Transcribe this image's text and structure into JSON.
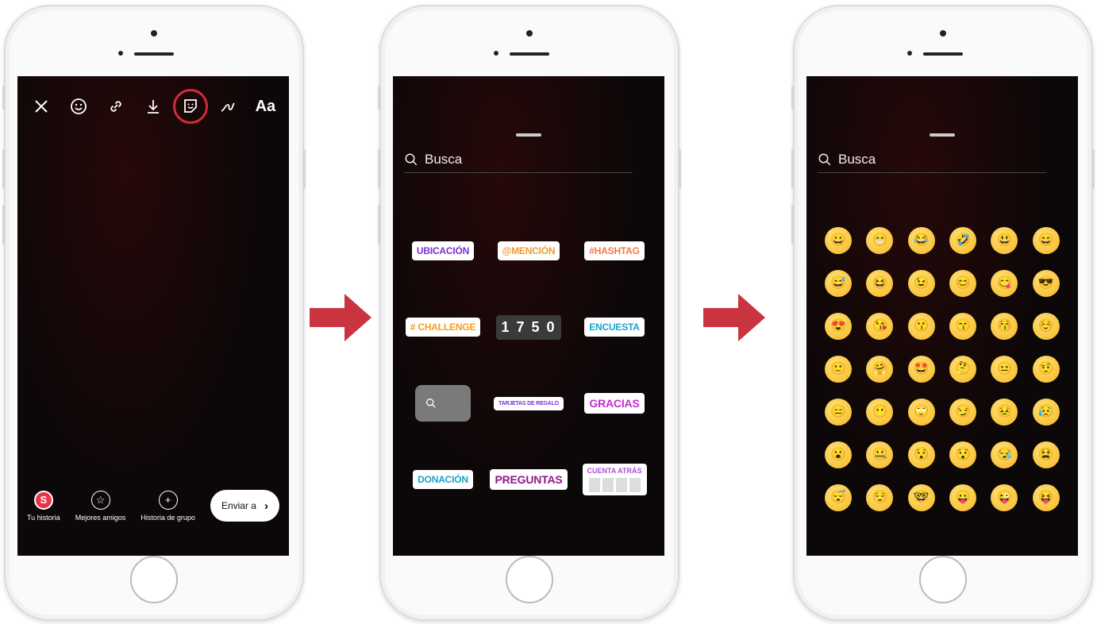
{
  "phone1": {
    "toolbar": {
      "close_icon": "close-icon",
      "face_effects_icon": "face-effects-icon",
      "link_icon": "link-icon",
      "download_icon": "download-icon",
      "sticker_icon": "sticker-icon",
      "draw_icon": "draw-icon",
      "text_label": "Aa"
    },
    "highlight_color": "#d22a3a",
    "bottom": {
      "your_story_initial": "S",
      "your_story_label": "Tu historia",
      "close_friends_label": "Mejores amigos",
      "group_story_label": "Historia de grupo",
      "send_label": "Enviar a"
    }
  },
  "phone2": {
    "search_placeholder": "Busca",
    "stickers": [
      {
        "label": "UBICACIÓN",
        "color": "#7a2fd0"
      },
      {
        "label": "@MENCIÓN",
        "color": "#f09a33"
      },
      {
        "label": "#HASHTAG",
        "color": "#f27a4a"
      },
      {
        "label": "# CHALLENGE",
        "color": "#f0a020"
      },
      {
        "label": "1 7 5 0",
        "color": "#ffffff"
      },
      {
        "label": "ENCUESTA",
        "color": "#1aa3c9"
      },
      {
        "label": "",
        "color": "#ffffff"
      },
      {
        "label": "TARJETAS DE REGALO",
        "color": "#7a2fd0"
      },
      {
        "label": "GRACIAS",
        "color": "#c42ad0"
      },
      {
        "label": "DONACIÓN",
        "color": "#1aa3c9"
      },
      {
        "label": "PREGUNTAS",
        "color": "#8a1a8a"
      },
      {
        "label": "CUENTA ATRÁS",
        "color": "#b050c8"
      }
    ]
  },
  "phone3": {
    "search_placeholder": "Busca",
    "emojis": [
      "😀",
      "😁",
      "😂",
      "🤣",
      "😃",
      "😄",
      "😅",
      "😆",
      "😉",
      "😊",
      "😋",
      "😎",
      "😍",
      "😘",
      "😗",
      "😙",
      "😚",
      "☺️",
      "🙂",
      "🤗",
      "🤩",
      "🤔",
      "😐",
      "🤨",
      "😑",
      "😶",
      "🙄",
      "😏",
      "😣",
      "😥",
      "😮",
      "🤐",
      "😯",
      "😯",
      "😪",
      "😫",
      "😴",
      "😌",
      "🤓",
      "😛",
      "😜",
      "😝"
    ]
  },
  "arrow_color": "#c93440"
}
